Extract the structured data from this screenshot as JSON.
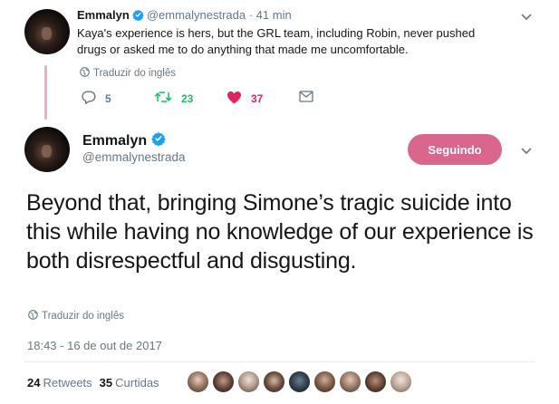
{
  "reply": {
    "name": "Emmalyn",
    "handle": "@emmalynestrada",
    "time": "· 41 min",
    "text": "Kaya's experience is hers, but the GRL team, including Robin, never pushed drugs or asked me to do anything that made me uncomfortable.",
    "translate": "Traduzir do inglês",
    "replies": "5",
    "retweets": "23",
    "likes": "37"
  },
  "tweet": {
    "name": "Emmalyn",
    "handle": "@emmalynestrada",
    "follow_label": "Seguindo",
    "text": "Beyond that, bringing Simone’s tragic suicide into this while having no knowledge of our experience is both disrespectful and disgusting.",
    "translate": "Traduzir do inglês",
    "timestamp": "18:43 - 16 de out de 2017",
    "retweets_count": "24",
    "retweets_label": "Retweets",
    "likes_count": "35",
    "likes_label": "Curtidas"
  },
  "colors": {
    "accent": "#d9668c",
    "verified": "#1da1f2",
    "retweet": "#17bf63",
    "like": "#e0245e",
    "muted": "#657786"
  },
  "icons": [
    "verified-icon",
    "globe-icon",
    "reply-icon",
    "retweet-icon",
    "heart-icon",
    "dm-icon",
    "chevron-down-icon"
  ]
}
